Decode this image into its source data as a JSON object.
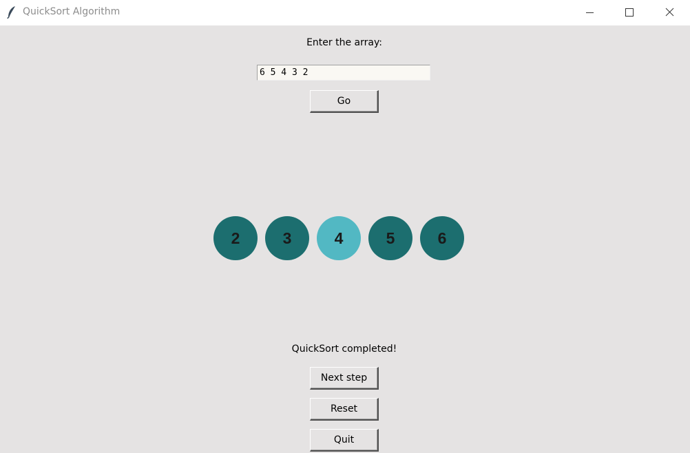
{
  "window": {
    "title": "QuickSort Algorithm",
    "app_icon": "feather-icon",
    "controls": [
      "minimize-icon",
      "maximize-icon",
      "close-icon"
    ]
  },
  "input": {
    "prompt": "Enter the array:",
    "value": "6 5 4 3 2",
    "go_label": "Go"
  },
  "array": {
    "circles": [
      {
        "value": "2",
        "color": "#1c6e6f"
      },
      {
        "value": "3",
        "color": "#1c6e6f"
      },
      {
        "value": "4",
        "color": "#52b8c3"
      },
      {
        "value": "5",
        "color": "#1c6e6f"
      },
      {
        "value": "6",
        "color": "#1c6e6f"
      }
    ]
  },
  "status": "QuickSort completed!",
  "controls": {
    "next_label": "Next step",
    "reset_label": "Reset",
    "quit_label": "Quit"
  }
}
